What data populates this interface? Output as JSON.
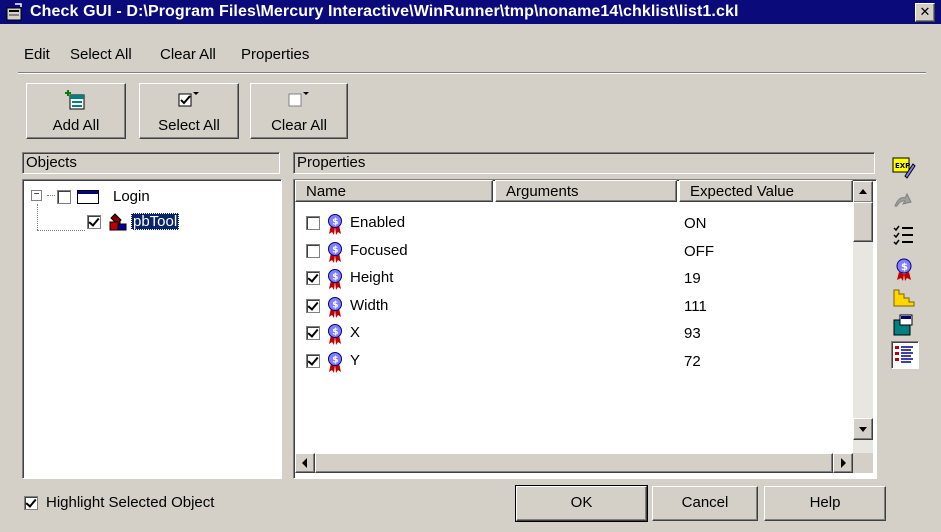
{
  "window": {
    "title": "Check GUI - D:\\Program Files\\Mercury Interactive\\WinRunner\\tmp\\noname14\\chklist\\list1.ckl",
    "close": "✕"
  },
  "menu": [
    {
      "label": "Edit"
    },
    {
      "label": "Select All"
    },
    {
      "label": "Clear All"
    },
    {
      "label": "Properties"
    }
  ],
  "toolbar": {
    "add_all": "Add All",
    "select_all": "Select All",
    "clear_all": "Clear All"
  },
  "objects": {
    "header": "Objects",
    "tree": [
      {
        "label": "Login",
        "expanded": true,
        "checked": false
      },
      {
        "label": "pbTool",
        "checked": true,
        "selected": true
      }
    ]
  },
  "properties": {
    "header": "Properties",
    "columns": [
      "Name",
      "Arguments",
      "Expected Value"
    ],
    "rows": [
      {
        "name": "Enabled",
        "arguments": "",
        "expected": "ON",
        "checked": false
      },
      {
        "name": "Focused",
        "arguments": "",
        "expected": "OFF",
        "checked": false
      },
      {
        "name": "Height",
        "arguments": "",
        "expected": "19",
        "checked": true
      },
      {
        "name": "Width",
        "arguments": "",
        "expected": "111",
        "checked": true
      },
      {
        "name": "X",
        "arguments": "",
        "expected": "93",
        "checked": true
      },
      {
        "name": "Y",
        "arguments": "",
        "expected": "72",
        "checked": true
      }
    ]
  },
  "side_toolbar": [
    "expected-value-edit-icon",
    "arguments-icon",
    "checklist-icon",
    "property-icon",
    "stairs-icon",
    "object-icon",
    "list-view-icon"
  ],
  "footer": {
    "highlight_label": "Highlight Selected Object",
    "highlight_checked": true,
    "ok": "OK",
    "cancel": "Cancel",
    "help": "Help"
  }
}
